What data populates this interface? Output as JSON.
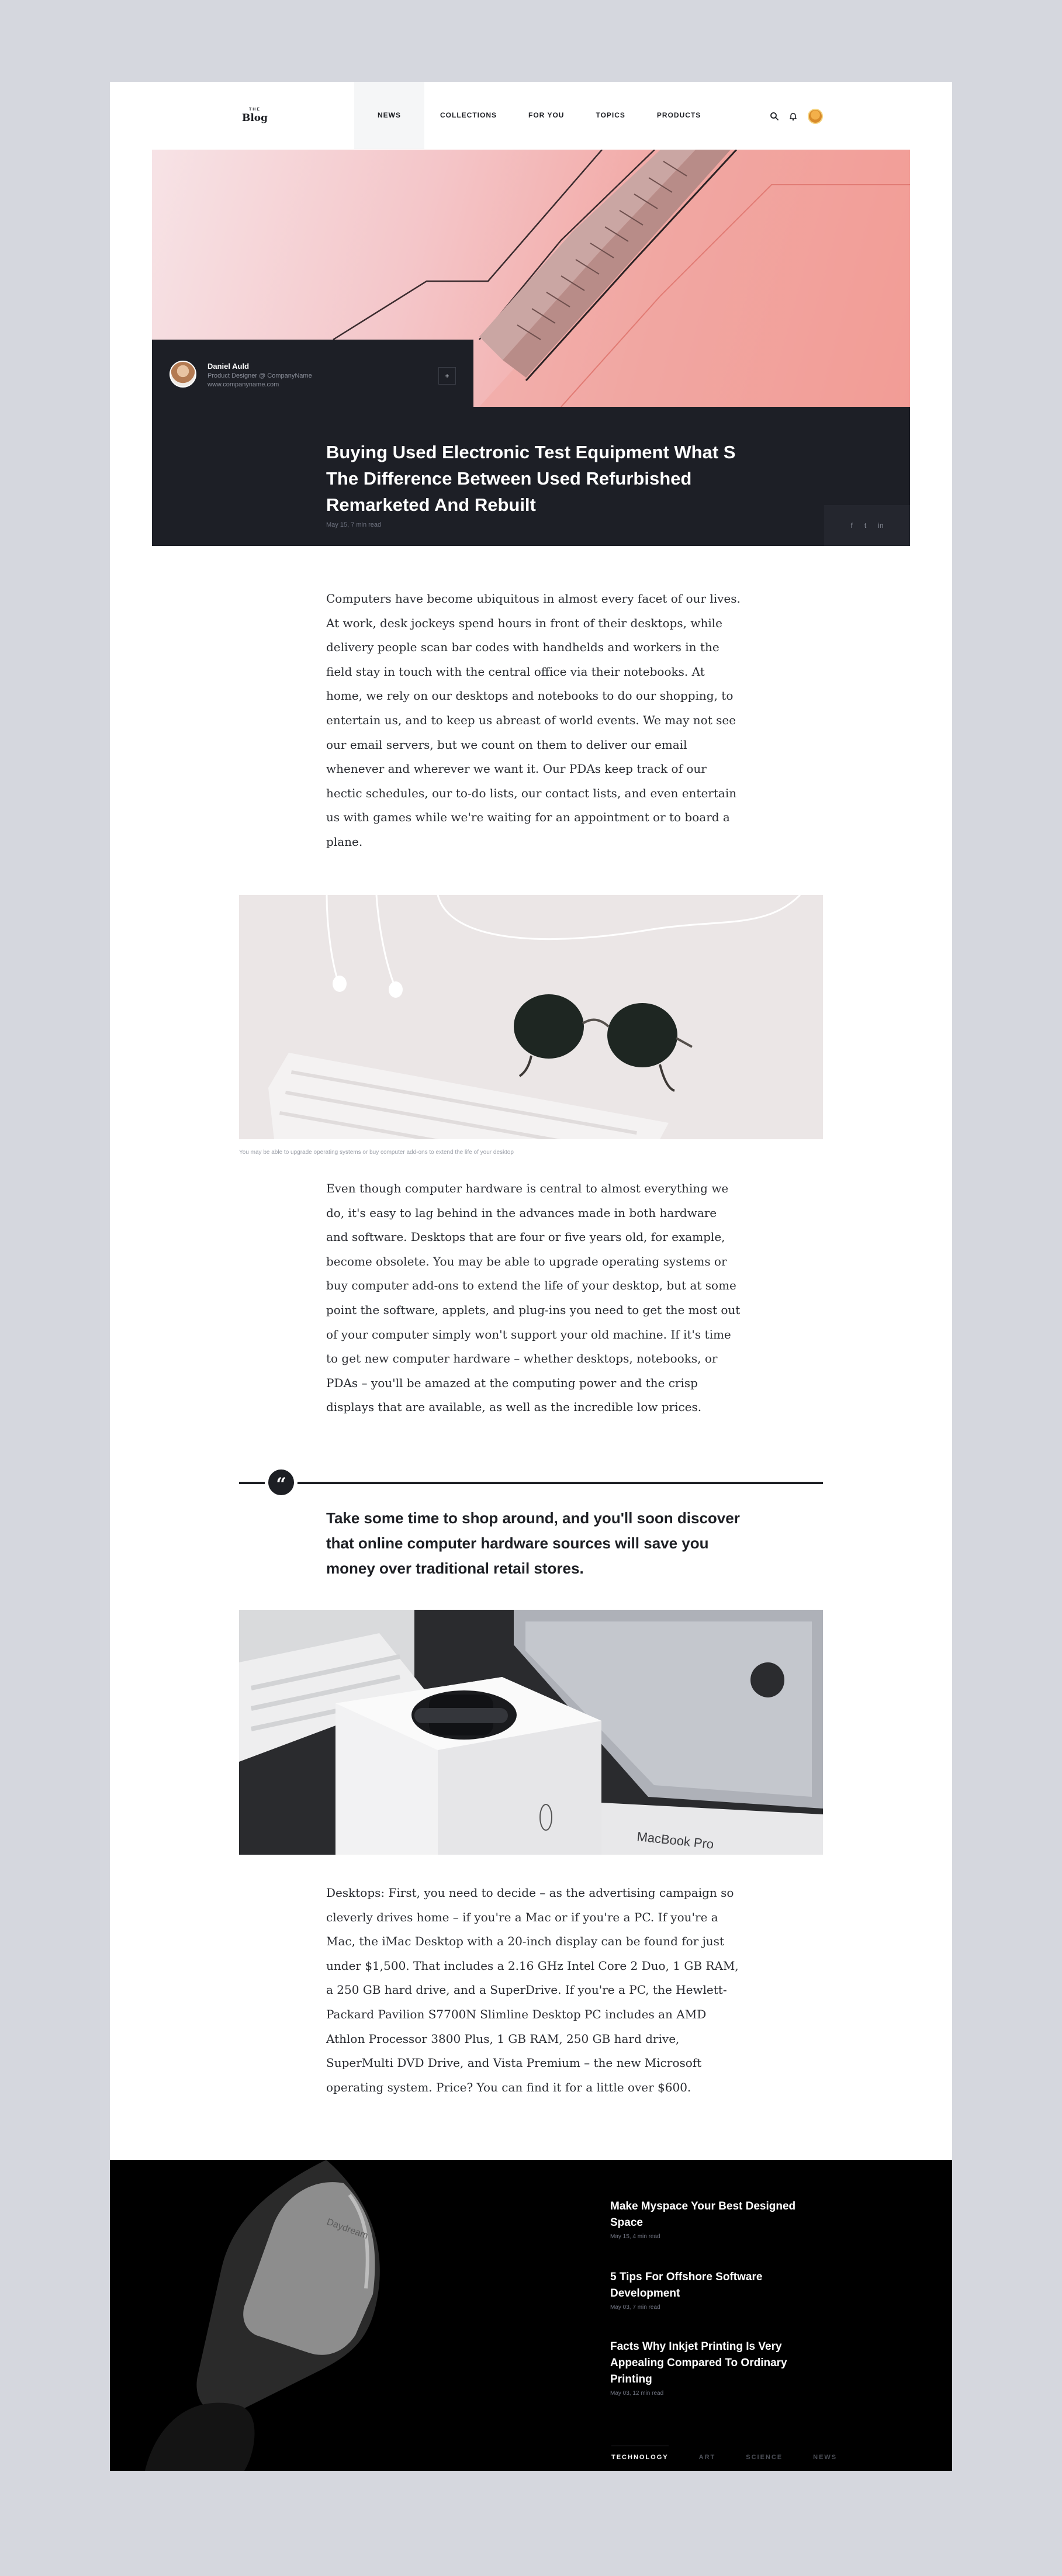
{
  "header": {
    "logo_small": "THE",
    "logo_big": "Blog",
    "nav": [
      {
        "label": "NEWS",
        "active": true
      },
      {
        "label": "COLLECTIONS",
        "active": false
      },
      {
        "label": "FOR YOU",
        "active": false
      },
      {
        "label": "TOPICS",
        "active": false
      },
      {
        "label": "PRODUCTS",
        "active": false
      }
    ],
    "icons": [
      "search-icon",
      "bell-icon",
      "user-avatar"
    ]
  },
  "hero": {
    "author_name": "Daniel Auld",
    "author_role": "Product Designer @ CompanyName",
    "author_site": "www.companyname.com",
    "author_button": "+",
    "title": "Buying Used Electronic Test Equipment What S The Difference Between Used Refurbished Remarketed And Rebuilt",
    "meta": "May 15, 7 min read",
    "share": [
      "f",
      "t",
      "in"
    ]
  },
  "article": {
    "para1": "Computers have become ubiquitous in almost every facet of our lives. At work, desk jockeys spend hours in front of their desktops, while delivery people scan bar codes with handhelds and workers in the field stay in touch with the central office via their notebooks. At home, we rely on our desktops and notebooks to do our shopping, to entertain us, and to keep us abreast of world events. We may not see our email servers, but we count on them to deliver our email whenever and wherever we want it. Our PDAs keep track of our hectic schedules, our to-do lists, our contact lists, and even entertain us with games while we're waiting for an appointment or to board a plane.",
    "caption1": "You may be able to upgrade operating systems or buy computer add-ons to extend the life of your desktop",
    "para2": "Even though computer hardware is central to almost everything we do, it's easy to lag behind in the advances made in both hardware and software. Desktops that are four or five years old, for example, become obsolete. You may be able to upgrade operating systems or buy computer add-ons to extend the life of your desktop, but at some point the software, applets, and plug-ins you need to get the most out of your computer simply won't support your old machine. If it's time to get new computer hardware – whether desktops, notebooks, or PDAs – you'll be amazed at the computing power and the crisp displays that are available, as well as the incredible low prices.",
    "quote_mark": "“",
    "quote": "Take some time to shop around, and you'll soon discover that online computer hardware sources will save you money over traditional retail stores.",
    "para3": "Desktops: First, you need to decide – as the advertising campaign so cleverly drives home – if you're a Mac or if you're a PC. If you're a Mac, the iMac Desktop with a 20-inch display can be found for just under $1,500. That includes a 2.16 GHz Intel Core 2 Duo, 1 GB RAM, a 250 GB hard drive, and a SuperDrive. If you're a PC, the Hewlett-Packard Pavilion S7700N Slimline Desktop PC includes an AMD Athlon Processor 3800 Plus, 1 GB RAM, 250 GB hard drive, SuperMulti DVD Drive, and Vista Premium – the new Microsoft operating system. Price? You can find it for a little over $600.",
    "macbook_label": "MacBook Pro"
  },
  "related": {
    "vr_label": "Daydream",
    "items": [
      {
        "title": "Make Myspace Your Best Designed Space",
        "meta": "May 15, 4 min read"
      },
      {
        "title": "5 Tips For Offshore Software Development",
        "meta": "May 03, 7 min read"
      },
      {
        "title": "Facts Why Inkjet Printing Is Very Appealing Compared To Ordinary Printing",
        "meta": "May 03, 12 min read"
      }
    ],
    "tabs": [
      {
        "label": "TECHNOLOGY",
        "active": true
      },
      {
        "label": "ART",
        "active": false
      },
      {
        "label": "SCIENCE",
        "active": false
      },
      {
        "label": "NEWS",
        "active": false
      }
    ]
  },
  "colors": {
    "page_bg": "#d5d7de",
    "dark": "#1d1f26",
    "hero_pink": "#f2a6a2",
    "black_band": "#000000"
  }
}
